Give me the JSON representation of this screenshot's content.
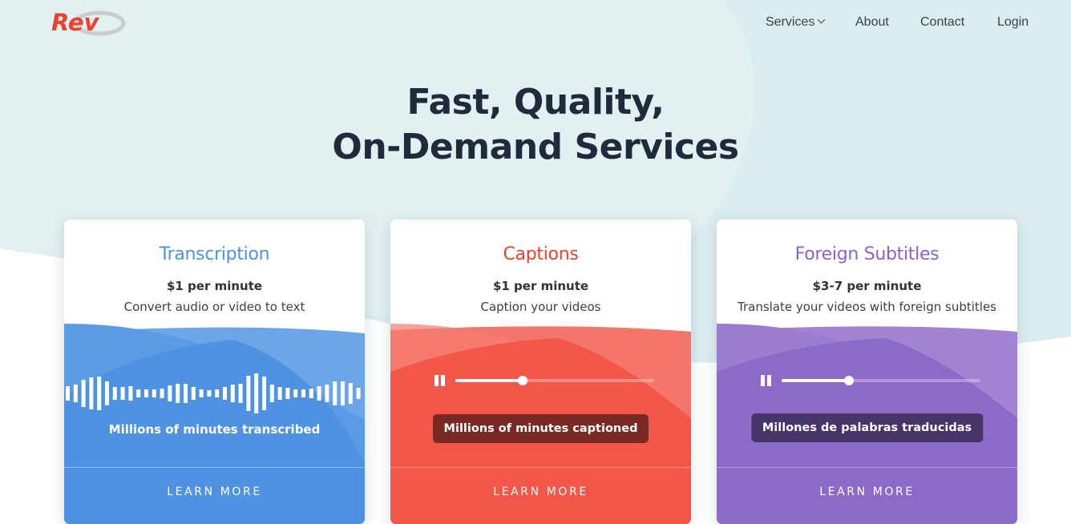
{
  "brand": {
    "logo_text": "Rev",
    "logo_color": "#e8432f"
  },
  "nav": {
    "items": [
      {
        "label": "Services",
        "has_dropdown": true
      },
      {
        "label": "About"
      },
      {
        "label": "Contact"
      },
      {
        "label": "Login"
      }
    ]
  },
  "hero": {
    "title_line1": "Fast, Quality,",
    "title_line2": "On-Demand Services"
  },
  "cards": [
    {
      "title": "Transcription",
      "price": "$1 per minute",
      "description": "Convert audio or video to text",
      "visual": "waveform",
      "caption": "Millions of minutes transcribed",
      "cta": "LEARN MORE",
      "accent": "#4f92e1"
    },
    {
      "title": "Captions",
      "price": "$1 per minute",
      "description": "Caption your videos",
      "visual": "player",
      "progress_percent": 34,
      "caption": "Millions of minutes captioned",
      "cta": "LEARN MORE",
      "accent": "#f2574a"
    },
    {
      "title": "Foreign Subtitles",
      "price": "$3-7 per minute",
      "description": "Translate your videos with foreign subtitles",
      "visual": "player",
      "progress_percent": 34,
      "caption": "Millones de palabras traducidas",
      "cta": "LEARN MORE",
      "accent": "#8d69c8"
    }
  ],
  "icons": {
    "pause": "pause-icon",
    "dropdown": "chevron-down-icon"
  },
  "colors": {
    "background_tint": "#e0eff1",
    "hero_text": "#1f2a3d",
    "captions_box": "#7a2a24",
    "subtitles_box": "#473468"
  }
}
